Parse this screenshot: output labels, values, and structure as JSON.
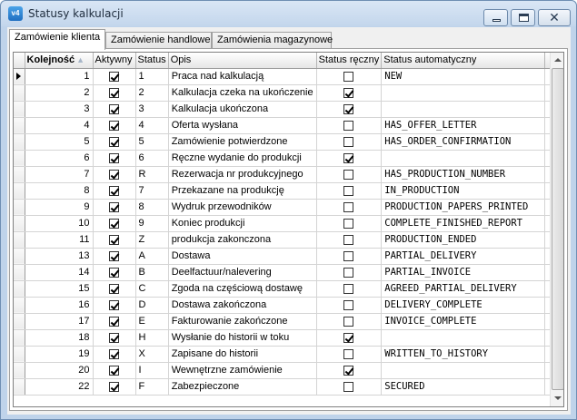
{
  "window": {
    "title": "Statusy kalkulacji",
    "icon_label": "v4"
  },
  "tabs": [
    {
      "label": "Zamówienie klienta",
      "active": true
    },
    {
      "label": "Zamówienie handlowe",
      "active": false
    },
    {
      "label": "Zamówienia magazynowe",
      "active": false
    }
  ],
  "grid": {
    "columns": {
      "kolejnosc": "Kolejność",
      "aktywny": "Aktywny",
      "status": "Status",
      "opis": "Opis",
      "status_reczny": "Status ręczny",
      "status_automatyczny": "Status automatyczny"
    },
    "rows": [
      {
        "kolejnosc": "1",
        "aktywny": true,
        "status": "1",
        "opis": "Praca nad kalkulacją",
        "reczny": false,
        "auto": "NEW"
      },
      {
        "kolejnosc": "2",
        "aktywny": true,
        "status": "2",
        "opis": "Kalkulacja czeka na ukończenie",
        "reczny": true,
        "auto": ""
      },
      {
        "kolejnosc": "3",
        "aktywny": true,
        "status": "3",
        "opis": "Kalkulacja ukończona",
        "reczny": true,
        "auto": ""
      },
      {
        "kolejnosc": "4",
        "aktywny": true,
        "status": "4",
        "opis": "Oferta wysłana",
        "reczny": false,
        "auto": "HAS_OFFER_LETTER"
      },
      {
        "kolejnosc": "5",
        "aktywny": true,
        "status": "5",
        "opis": "Zamówienie potwierdzone",
        "reczny": false,
        "auto": "HAS_ORDER_CONFIRMATION"
      },
      {
        "kolejnosc": "6",
        "aktywny": true,
        "status": "6",
        "opis": "Ręczne wydanie do produkcji",
        "reczny": true,
        "auto": ""
      },
      {
        "kolejnosc": "7",
        "aktywny": true,
        "status": "R",
        "opis": "Rezerwacja nr produkcyjnego",
        "reczny": false,
        "auto": "HAS_PRODUCTION_NUMBER"
      },
      {
        "kolejnosc": "8",
        "aktywny": true,
        "status": "7",
        "opis": "Przekazane na produkcję",
        "reczny": false,
        "auto": "IN_PRODUCTION"
      },
      {
        "kolejnosc": "9",
        "aktywny": true,
        "status": "8",
        "opis": "Wydruk przewodników",
        "reczny": false,
        "auto": "PRODUCTION_PAPERS_PRINTED"
      },
      {
        "kolejnosc": "10",
        "aktywny": true,
        "status": "9",
        "opis": "Koniec produkcji",
        "reczny": false,
        "auto": "COMPLETE_FINISHED_REPORT"
      },
      {
        "kolejnosc": "11",
        "aktywny": true,
        "status": "Z",
        "opis": "produkcja zakonczona",
        "reczny": false,
        "auto": "PRODUCTION_ENDED"
      },
      {
        "kolejnosc": "13",
        "aktywny": true,
        "status": "A",
        "opis": "Dostawa",
        "reczny": false,
        "auto": "PARTIAL_DELIVERY"
      },
      {
        "kolejnosc": "14",
        "aktywny": true,
        "status": "B",
        "opis": "Deelfactuur/nalevering",
        "reczny": false,
        "auto": "PARTIAL_INVOICE"
      },
      {
        "kolejnosc": "15",
        "aktywny": true,
        "status": "C",
        "opis": "Zgoda na częściową dostawę",
        "reczny": false,
        "auto": "AGREED_PARTIAL_DELIVERY"
      },
      {
        "kolejnosc": "16",
        "aktywny": true,
        "status": "D",
        "opis": "Dostawa zakończona",
        "reczny": false,
        "auto": "DELIVERY_COMPLETE"
      },
      {
        "kolejnosc": "17",
        "aktywny": true,
        "status": "E",
        "opis": "Fakturowanie zakończone",
        "reczny": false,
        "auto": "INVOICE_COMPLETE"
      },
      {
        "kolejnosc": "18",
        "aktywny": true,
        "status": "H",
        "opis": "Wysłanie do historii w toku",
        "reczny": true,
        "auto": ""
      },
      {
        "kolejnosc": "19",
        "aktywny": true,
        "status": "X",
        "opis": "Zapisane do historii",
        "reczny": false,
        "auto": "WRITTEN_TO_HISTORY"
      },
      {
        "kolejnosc": "20",
        "aktywny": true,
        "status": "I",
        "opis": "Wewnętrzne zamówienie",
        "reczny": true,
        "auto": ""
      },
      {
        "kolejnosc": "22",
        "aktywny": true,
        "status": "F",
        "opis": "Zabezpieczone",
        "reczny": false,
        "auto": "SECURED"
      }
    ]
  }
}
